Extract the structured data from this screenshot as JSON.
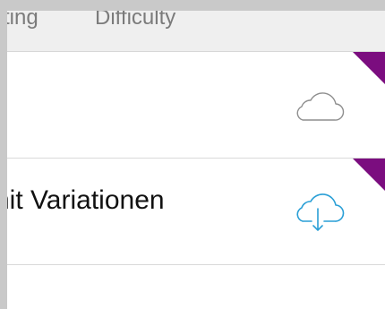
{
  "header": {
    "rating_label": "ting",
    "difficulty_label": "Difficulty"
  },
  "rows": [
    {
      "title": "",
      "icon": "cloud-icon",
      "corner_color": "#7b0d7f"
    },
    {
      "title": "nit Variationen",
      "icon": "cloud-download-icon",
      "icon_color": "#2a9fd6",
      "corner_color": "#7b0d7f"
    },
    {
      "title": ""
    }
  ]
}
